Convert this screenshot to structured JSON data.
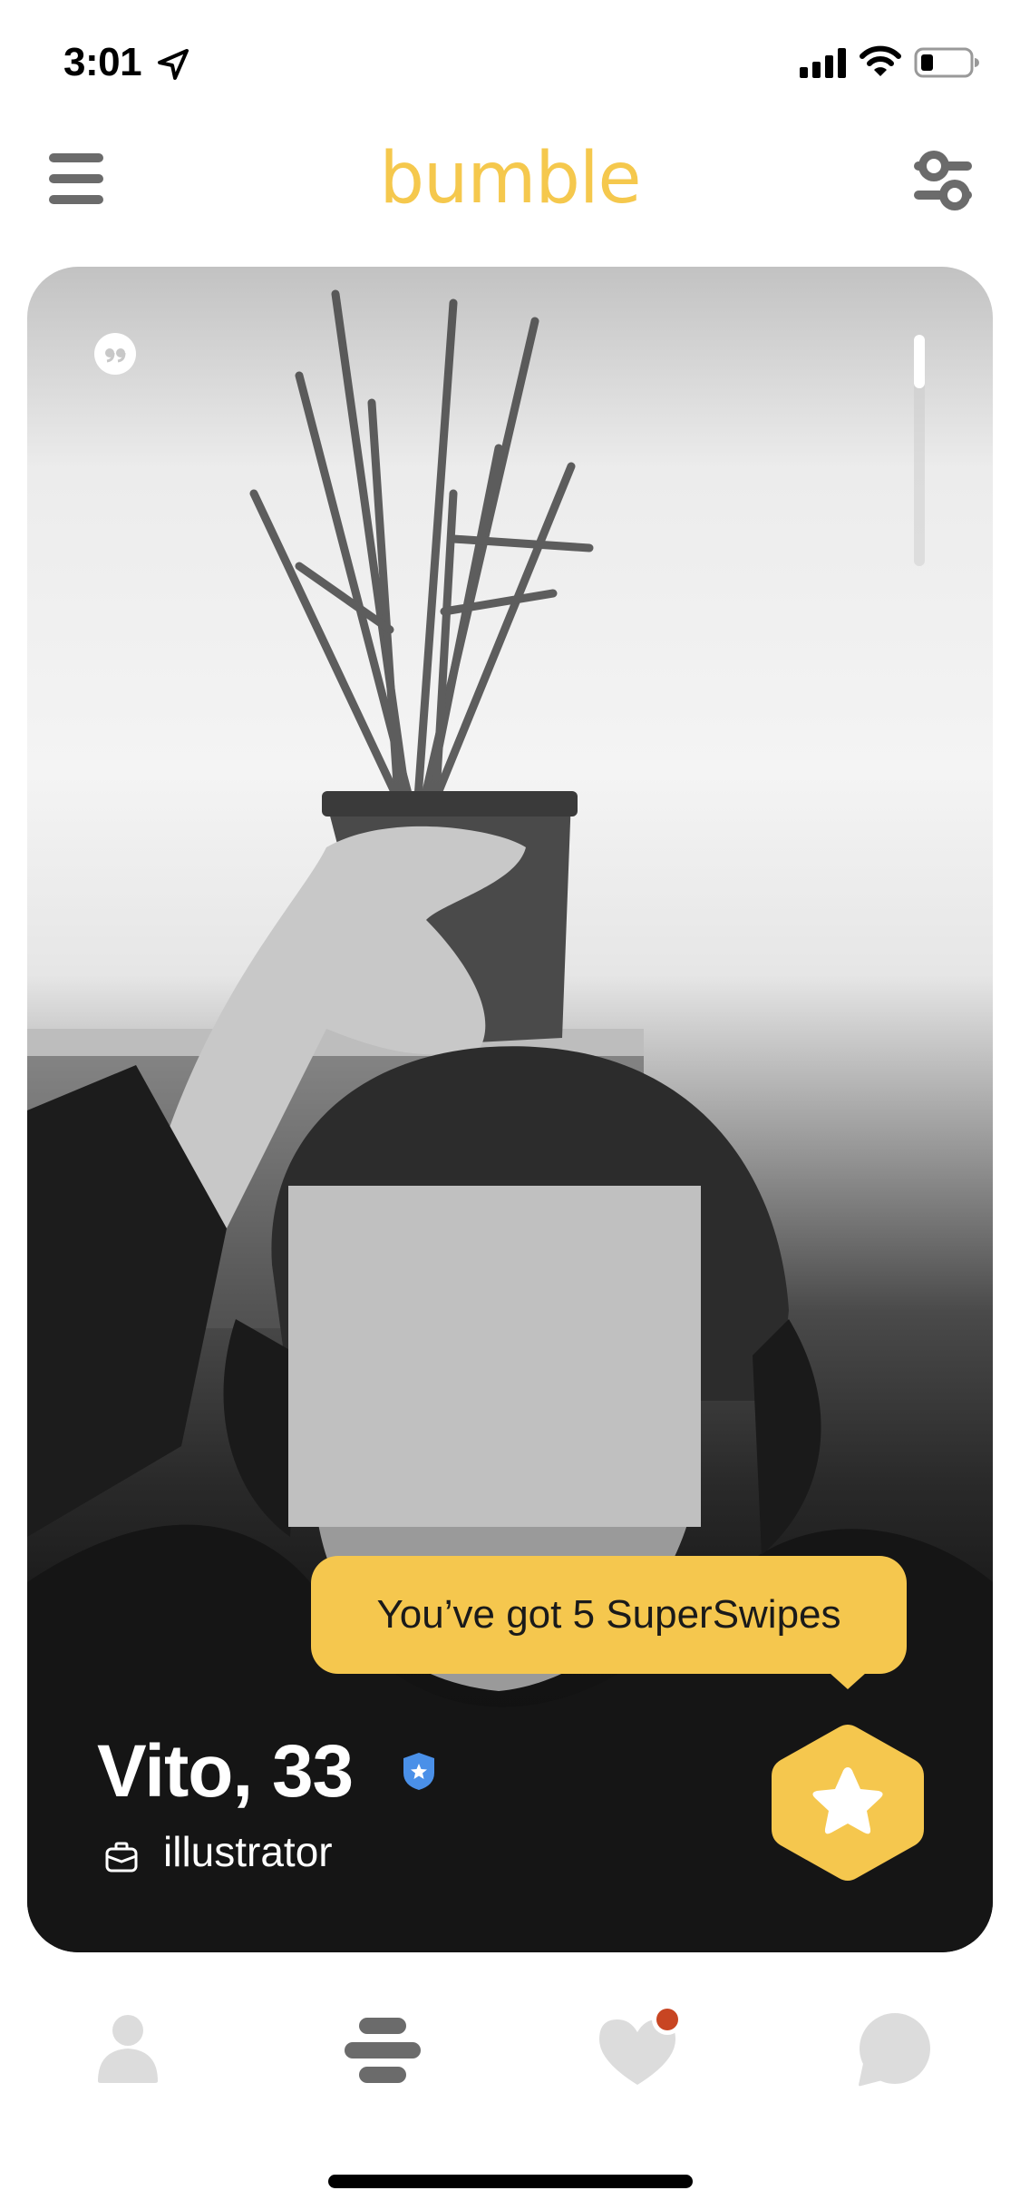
{
  "status_bar": {
    "time": "3:01",
    "location_icon": "location-arrow-icon",
    "signal_icon": "cellular-signal-icon",
    "wifi_icon": "wifi-icon",
    "battery_icon": "battery-low-icon"
  },
  "header": {
    "menu_icon": "hamburger-menu-icon",
    "logo": "bumble",
    "filter_icon": "filter-sliders-icon"
  },
  "profile_card": {
    "quote_icon": "quote-icon",
    "photo_progress": 0.23,
    "tooltip": "You’ve got 5 SuperSwipes",
    "superswipe_icon": "star-icon",
    "name_age": "Vito, 33",
    "verified_icon": "verified-badge-icon",
    "job_icon": "briefcase-icon",
    "job": "illustrator"
  },
  "bottom_nav": {
    "items": [
      {
        "name": "profile",
        "icon": "person-icon",
        "active": false
      },
      {
        "name": "discover",
        "icon": "hive-icon",
        "active": true
      },
      {
        "name": "likes",
        "icon": "heart-icon",
        "active": false,
        "badge": true
      },
      {
        "name": "chats",
        "icon": "chat-bubble-icon",
        "active": false
      }
    ]
  },
  "colors": {
    "brand_yellow": "#F5C74E",
    "icon_active": "#6B6B6B",
    "icon_inactive": "#DCDCDC",
    "notification_red": "#C84522",
    "verified_blue": "#4A90E8"
  }
}
